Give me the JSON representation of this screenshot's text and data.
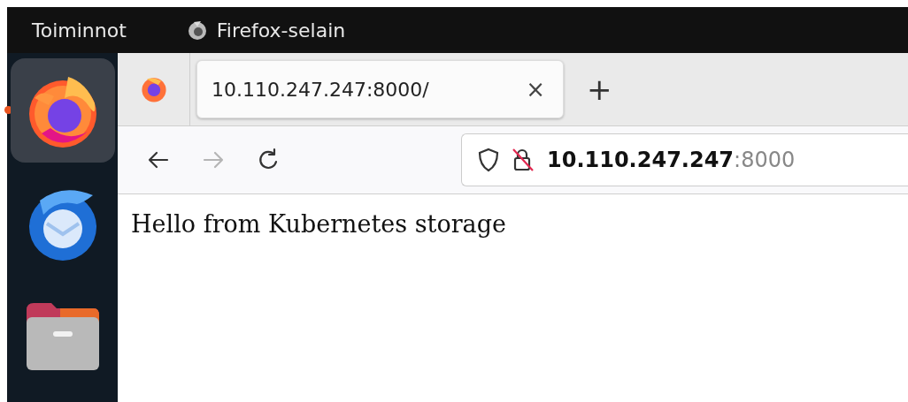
{
  "top_bar": {
    "activities": "Toiminnot",
    "app_name": "Firefox-selain"
  },
  "dock": {
    "items": [
      {
        "kind": "firefox",
        "selected": true,
        "running": true
      },
      {
        "kind": "thunderbird",
        "selected": false,
        "running": false
      },
      {
        "kind": "files",
        "selected": false,
        "running": false
      }
    ]
  },
  "browser": {
    "tabs": [
      {
        "title": "10.110.247.247:8000/",
        "selected": true
      }
    ],
    "tab_close": "×",
    "new_tab": "+",
    "nav": {
      "back_disabled": false,
      "forward_disabled": true
    },
    "address": {
      "host": "10.110.247.247",
      "port": ":8000"
    }
  },
  "page": {
    "text": "Hello from Kubernetes storage"
  }
}
